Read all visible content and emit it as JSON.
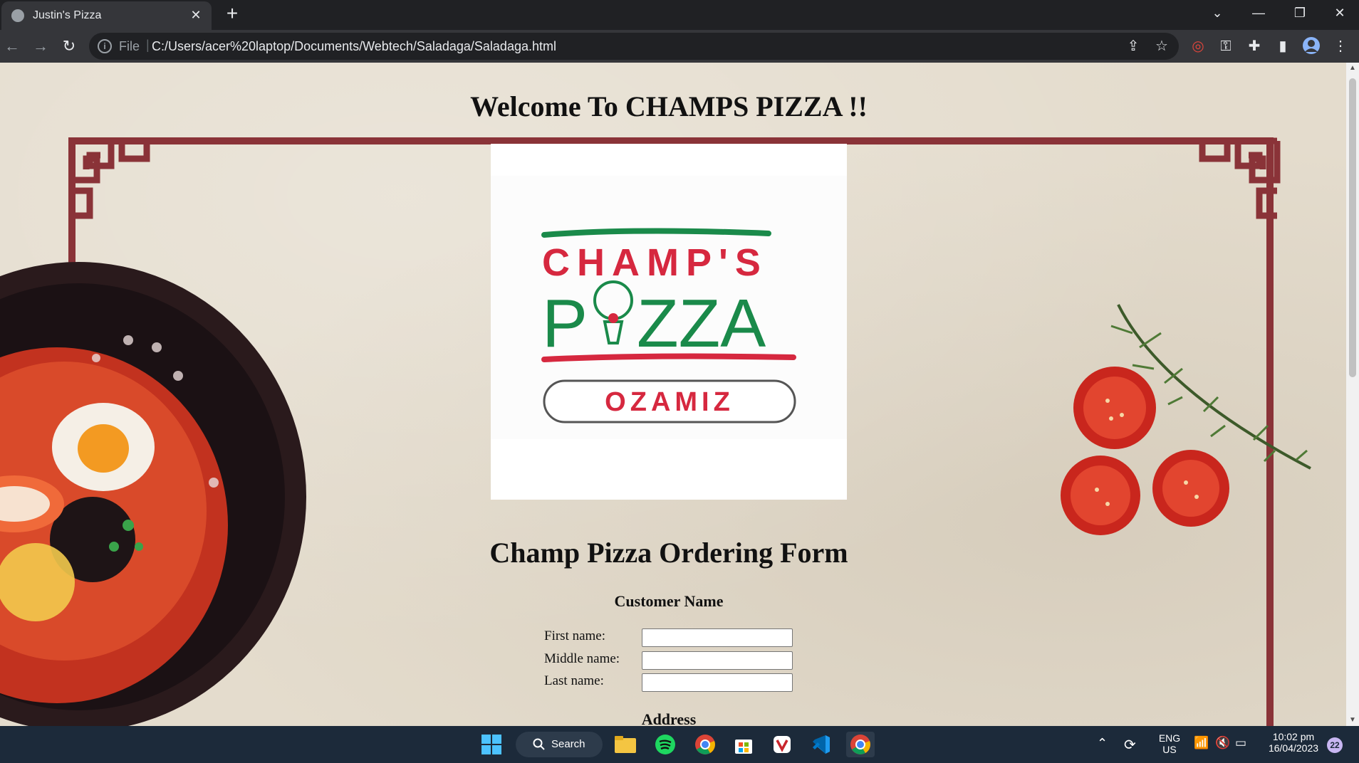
{
  "browser": {
    "tab_title": "Justin's Pizza",
    "tab_close_glyph": "✕",
    "new_tab_glyph": "+",
    "window_controls": [
      "⌄",
      "—",
      "❐",
      "✕"
    ],
    "url_scheme": "File",
    "url": "C:/Users/acer%20laptop/Documents/Webtech/Saladaga/Saladaga.html",
    "nav": [
      "←",
      "→",
      "↻"
    ]
  },
  "page": {
    "welcome_heading": "Welcome To CHAMPS PIZZA !!",
    "logo": {
      "line1": "CHAMP'S",
      "line2a": "P",
      "line2b": "ZZA",
      "badge": "OZAMIZ"
    },
    "form_title": "Champ Pizza Ordering Form",
    "customer_name_heading": "Customer Name",
    "fields": [
      {
        "label": "First name:",
        "value": ""
      },
      {
        "label": "Middle name:",
        "value": ""
      },
      {
        "label": "Last name:",
        "value": ""
      }
    ],
    "address_heading": "Address"
  },
  "taskbar": {
    "search_label": "Search",
    "lang_line1": "ENG",
    "lang_line2": "US",
    "time": "10:02 pm",
    "date": "16/04/2023",
    "notification_count": "22"
  },
  "colors": {
    "frame": "#8a3338",
    "logo_red": "#d6283f",
    "logo_green": "#1a8a4a"
  }
}
